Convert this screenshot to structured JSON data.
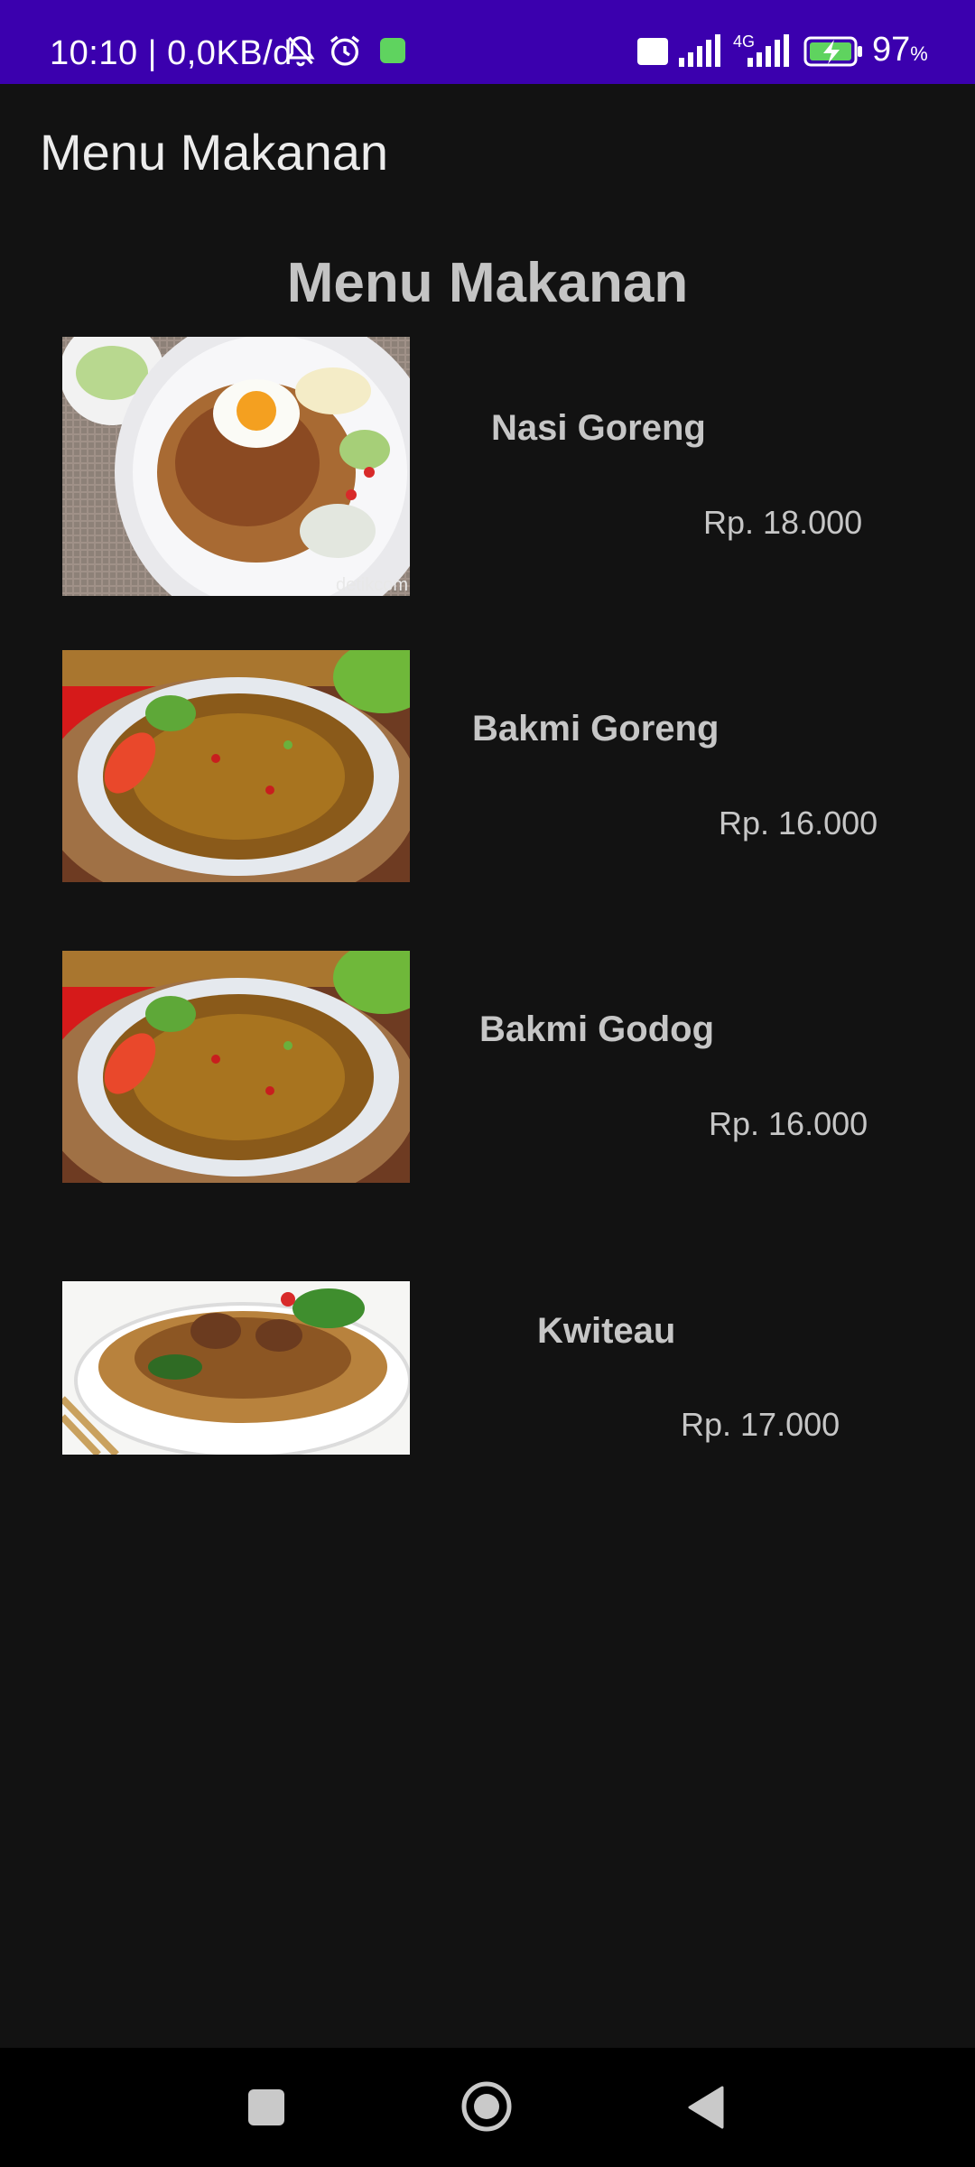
{
  "status_bar": {
    "time_speed": "10:10 | 0,0KB/d",
    "network": "4G",
    "battery_percent": "97",
    "battery_unit": "%"
  },
  "toolbar": {
    "title": "Menu Makanan"
  },
  "section_title": "Menu Makanan",
  "menu": [
    {
      "name": "Nasi Goreng",
      "price": "Rp. 18.000",
      "image": "nasi-goreng-photo",
      "watermark": "detikcom"
    },
    {
      "name": "Bakmi Goreng",
      "price": "Rp. 16.000",
      "image": "bakmi-goreng-photo"
    },
    {
      "name": "Bakmi Godog",
      "price": "Rp. 16.000",
      "image": "bakmi-godog-photo"
    },
    {
      "name": "Kwiteau",
      "price": "Rp. 17.000",
      "image": "kwiteau-photo"
    }
  ],
  "nav": {
    "recents": "square-icon",
    "home": "circle-home-icon",
    "back": "triangle-back-icon"
  },
  "colors": {
    "status_bar": "#3b00ae",
    "background": "#121212",
    "text": "#c6c6c6"
  }
}
